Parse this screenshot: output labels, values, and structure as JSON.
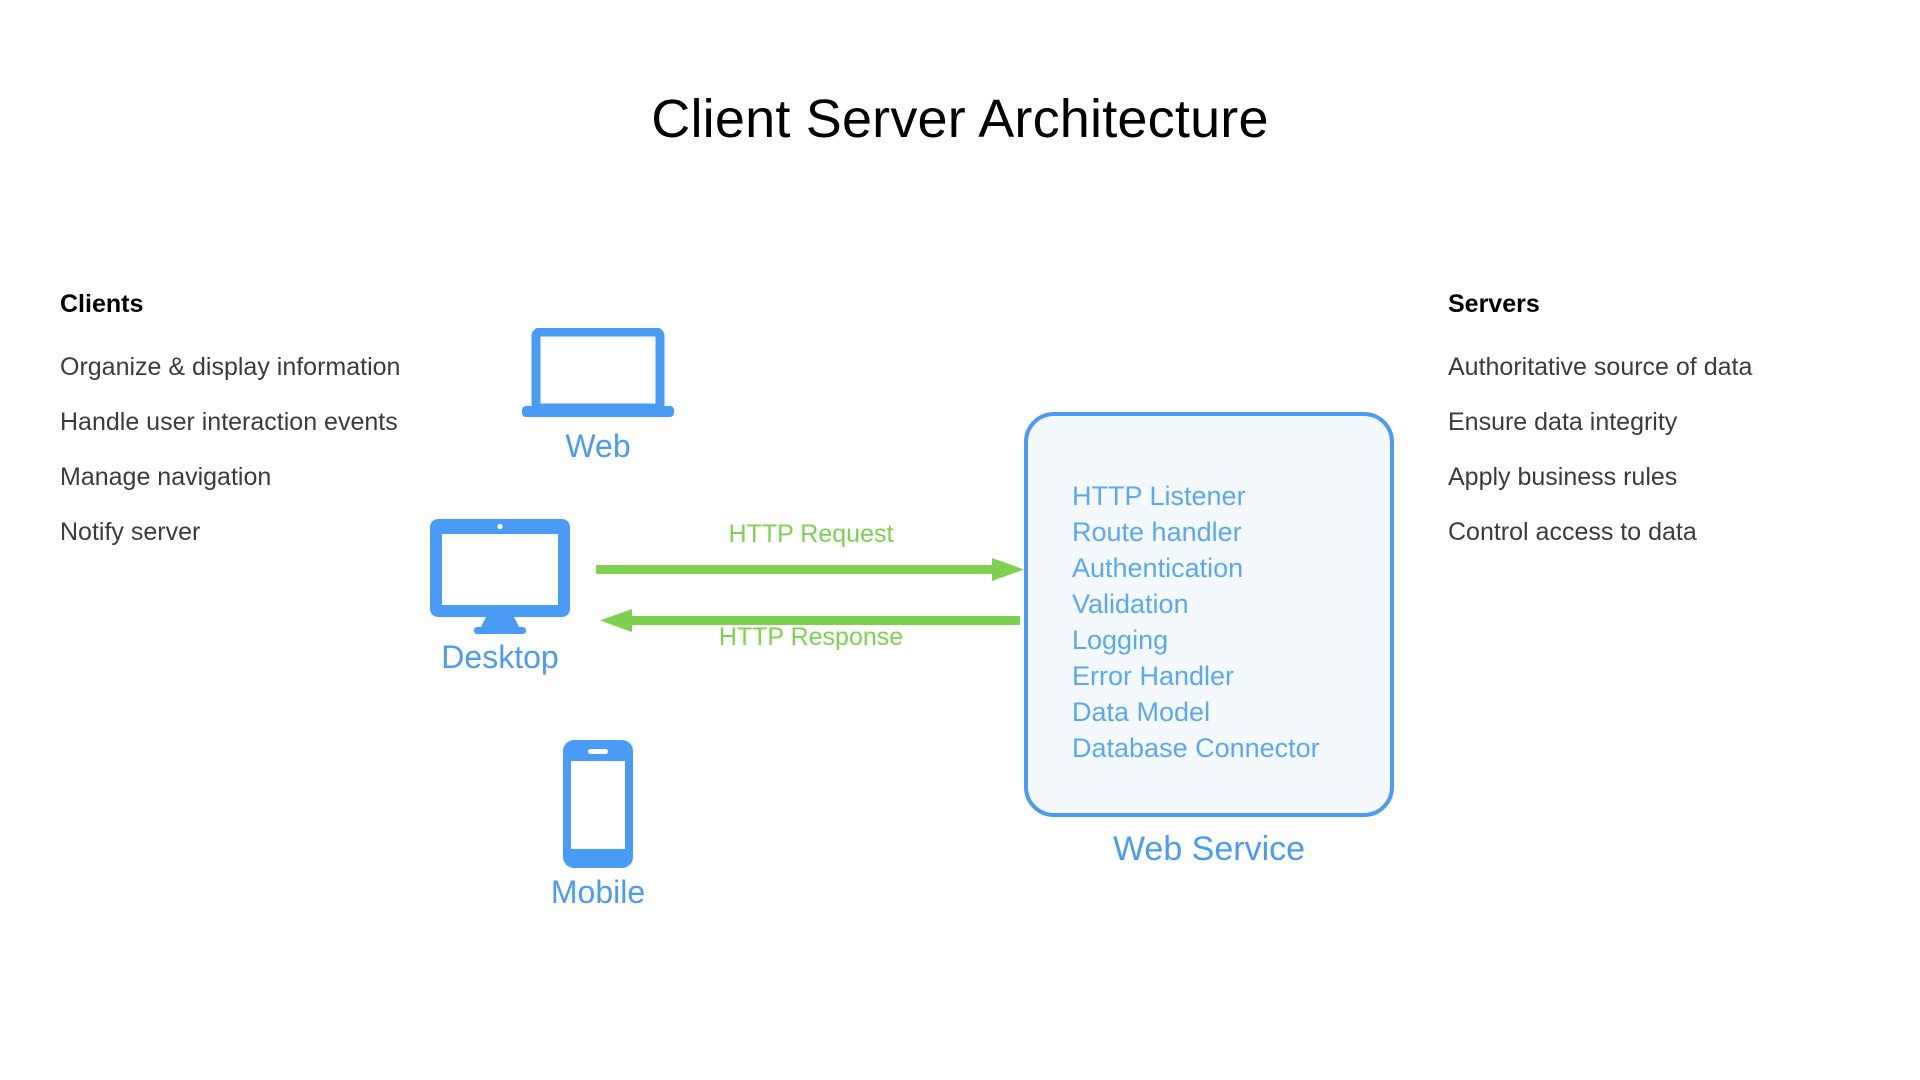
{
  "title": "Client Server Architecture",
  "colors": {
    "blue": "#4a9bf5",
    "blue_text": "#5aa8f5",
    "green": "#7ed14f",
    "body_text": "#3b3b3b",
    "box_fill": "#f4f9fe"
  },
  "clients": {
    "heading": "Clients",
    "items": [
      "Organize & display information",
      "Handle user interaction events",
      "Manage navigation",
      "Notify server"
    ]
  },
  "servers": {
    "heading": "Servers",
    "items": [
      "Authoritative source of data",
      "Ensure data integrity",
      "Apply business rules",
      "Control access to data"
    ]
  },
  "devices": [
    {
      "label": "Web",
      "icon": "laptop-icon"
    },
    {
      "label": "Desktop",
      "icon": "monitor-icon"
    },
    {
      "label": "Mobile",
      "icon": "phone-icon"
    }
  ],
  "arrows": {
    "request_label": "HTTP Request",
    "response_label": "HTTP Response"
  },
  "service": {
    "label": "Web Service",
    "items": [
      "HTTP Listener",
      "Route handler",
      "Authentication",
      "Validation",
      "Logging",
      "Error Handler",
      "Data Model",
      "Database Connector"
    ]
  }
}
